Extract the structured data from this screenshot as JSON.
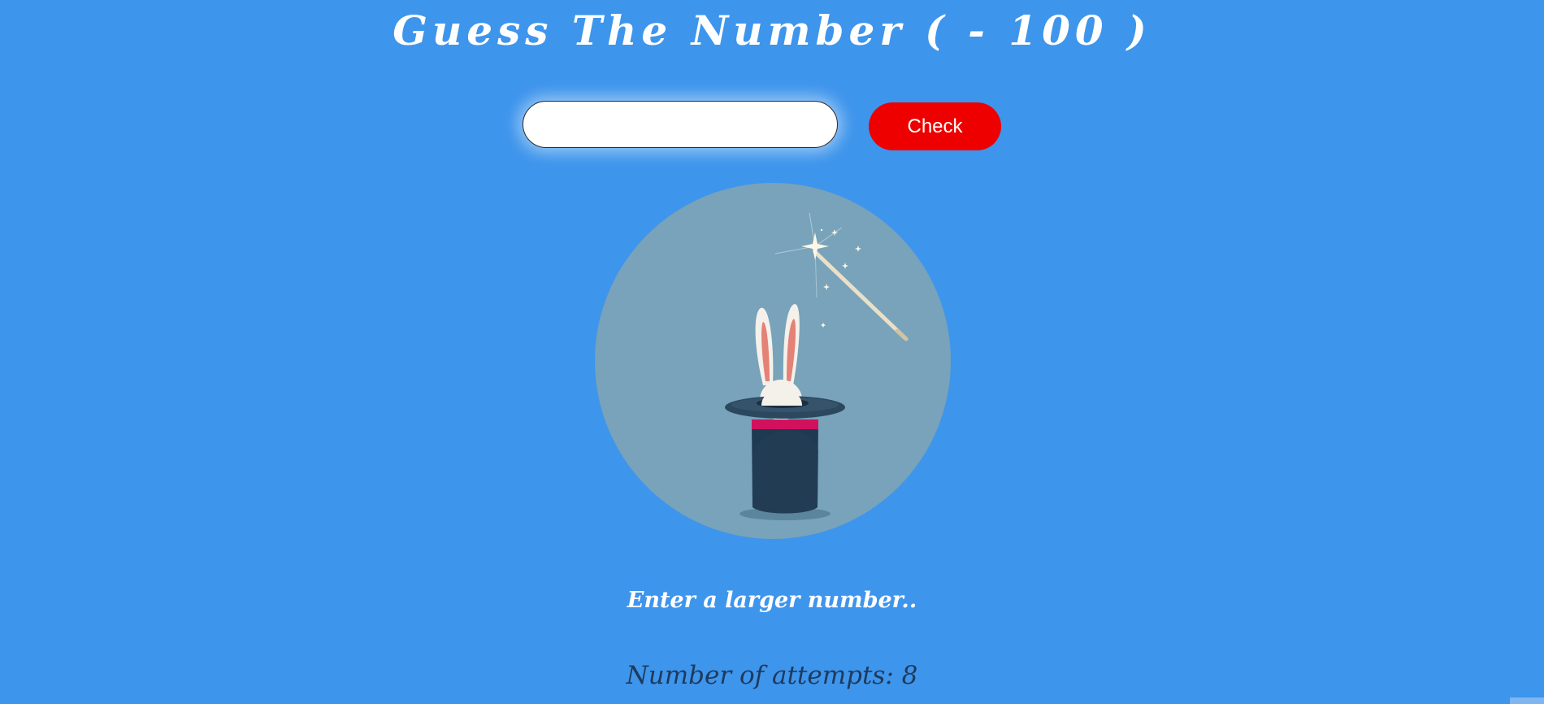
{
  "header": {
    "title": "Guess The Number ( - 100 )"
  },
  "guess_form": {
    "input_value": "",
    "check_label": "Check"
  },
  "illustration": {
    "icon": "magic-hat-rabbit-wand-icon"
  },
  "feedback": {
    "message": "Enter a larger number..",
    "attempts_text": "Number of attempts: 8"
  },
  "colors": {
    "background": "#3e95ec",
    "check_button": "#ee0000",
    "circle": "#78a3ba",
    "attempts_text": "#1e3a5c"
  }
}
